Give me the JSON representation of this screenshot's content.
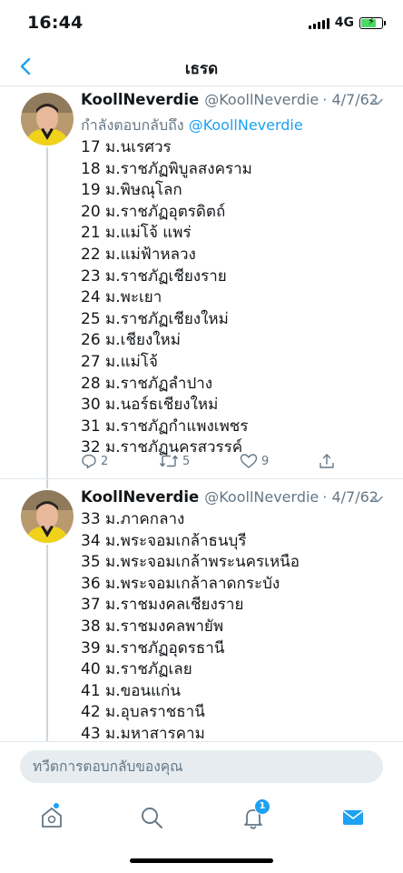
{
  "status_bar": {
    "time": "16:44",
    "network": "4G",
    "battery_level": 0.65
  },
  "header": {
    "title": "เธรด"
  },
  "tweets": [
    {
      "display_name": "KoollNeverdie",
      "handle": "@KoollNeverdie",
      "date": "· 4/7/62",
      "reply_to_prefix": "กำลังตอบกลับถึง",
      "reply_to_handle": "@KoollNeverdie",
      "lines": [
        "17 ม.นเรศวร",
        "18 ม.ราชภัฏพิบูลสงคราม",
        "19 ม.พิษณุโลก",
        "20 ม.ราชภัฏอุตรดิตถ์",
        "21 ม.แม่โจ้ แพร่",
        "22 ม.แม่ฟ้าหลวง",
        "23 ม.ราชภัฏเชียงราย",
        "24 ม.พะเยา",
        "25 ม.ราชภัฏเชียงใหม่",
        "26 ม.เชียงใหม่",
        "27 ม.แม่โจ้",
        "28 ม.ราชภัฏลำปาง",
        "30 ม.นอร์ธเชียงใหม่",
        "31 ม.ราชภัฏกำแพงเพชร",
        "32 ม.ราชภัฏนครสวรรค์"
      ],
      "replies": "2",
      "retweets": "5",
      "likes": "9"
    },
    {
      "display_name": "KoollNeverdie",
      "handle": "@KoollNeverdie",
      "date": "· 4/7/62",
      "lines": [
        "33 ม.ภาคกลาง",
        "34 ม.พระจอมเกล้าธนบุรี",
        "35 ม.พระจอมเกล้าพระนครเหนือ",
        "36 ม.พระจอมเกล้าลาดกระบัง",
        "37 ม.ราชมงคลเชียงราย",
        "38 ม.ราชมงคลพายัพ",
        "39 ม.ราชภัฏอุดรธานี",
        "40 ม.ราชภัฏเลย",
        "41 ม.ขอนแก่น",
        "42 ม.อุบลราชธานี",
        "43 ม.มหาสารคาม"
      ]
    }
  ],
  "compose": {
    "placeholder": "ทวีตการตอบกลับของคุณ"
  },
  "tab_bar": {
    "notifications_count": "1"
  },
  "colors": {
    "accent": "#1da1f2",
    "muted": "#657786",
    "text": "#14171a"
  },
  "icons": {
    "back": "chevron-left-icon",
    "reply": "reply-icon",
    "retweet": "retweet-icon",
    "like": "heart-icon",
    "share": "share-icon",
    "home": "home-icon",
    "search": "search-icon",
    "notifications": "bell-icon",
    "messages": "mail-icon"
  }
}
